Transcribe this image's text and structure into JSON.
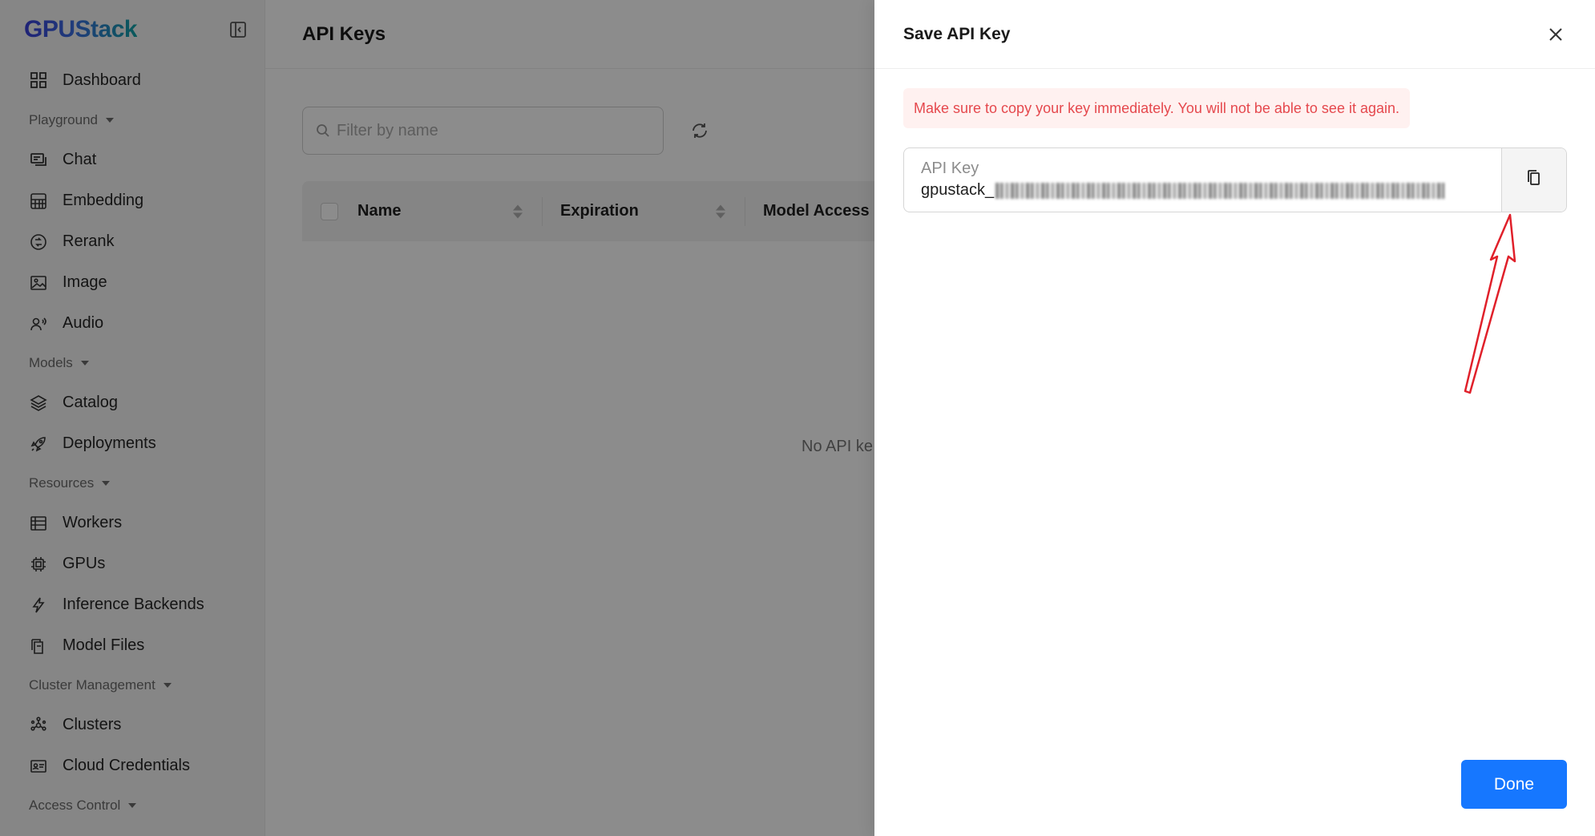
{
  "app": {
    "logo": "GPUStack"
  },
  "sidebar": {
    "items": [
      {
        "label": "Dashboard",
        "icon": "dashboard-icon"
      },
      {
        "label": "Playground",
        "type": "group"
      },
      {
        "label": "Chat",
        "icon": "chat-icon"
      },
      {
        "label": "Embedding",
        "icon": "embedding-icon"
      },
      {
        "label": "Rerank",
        "icon": "rerank-icon"
      },
      {
        "label": "Image",
        "icon": "image-icon"
      },
      {
        "label": "Audio",
        "icon": "audio-icon"
      },
      {
        "label": "Models",
        "type": "group"
      },
      {
        "label": "Catalog",
        "icon": "catalog-icon"
      },
      {
        "label": "Deployments",
        "icon": "rocket-icon"
      },
      {
        "label": "Resources",
        "type": "group"
      },
      {
        "label": "Workers",
        "icon": "workers-icon"
      },
      {
        "label": "GPUs",
        "icon": "gpu-icon"
      },
      {
        "label": "Inference Backends",
        "icon": "lightning-icon"
      },
      {
        "label": "Model Files",
        "icon": "files-icon"
      },
      {
        "label": "Cluster Management",
        "type": "group"
      },
      {
        "label": "Clusters",
        "icon": "clusters-icon"
      },
      {
        "label": "Cloud Credentials",
        "icon": "credentials-icon"
      },
      {
        "label": "Access Control",
        "type": "group"
      }
    ]
  },
  "main": {
    "title": "API Keys",
    "search_placeholder": "Filter by name",
    "columns": {
      "name": "Name",
      "expiration": "Expiration",
      "model_access": "Model Access"
    },
    "empty_text": "No API ke"
  },
  "drawer": {
    "title": "Save API Key",
    "alert": "Make sure to copy your key immediately. You will not be able to see it again.",
    "key_label": "API Key",
    "key_prefix": "gpustack_",
    "done_label": "Done"
  },
  "colors": {
    "primary": "#1677ff",
    "alert_text": "#e5484d",
    "alert_bg": "#fff1f0",
    "annotation_arrow": "#e0202a"
  }
}
